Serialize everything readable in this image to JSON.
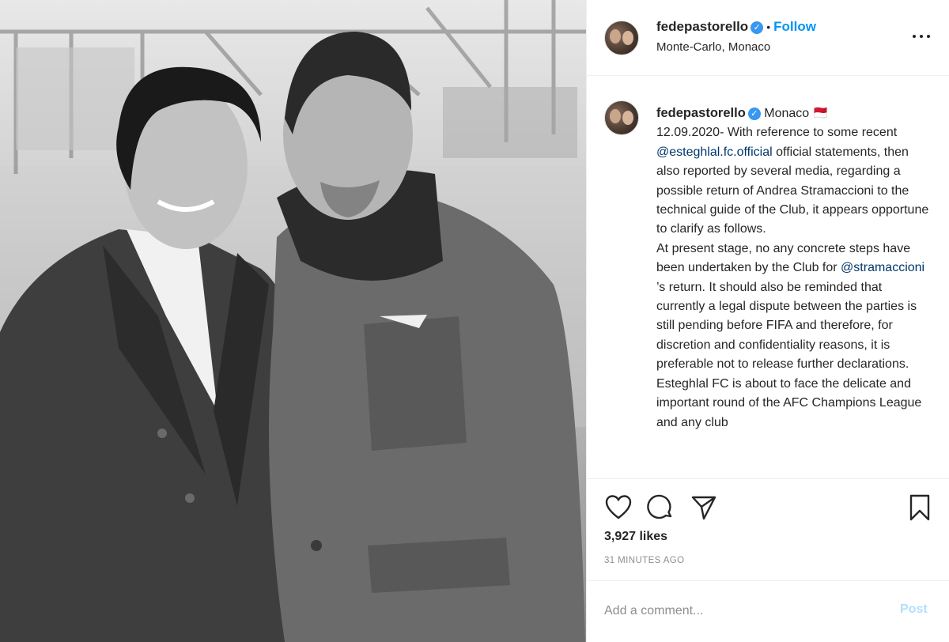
{
  "header": {
    "username": "fedepastorello",
    "follow_label": "Follow",
    "location": "Monte-Carlo, Monaco"
  },
  "caption": {
    "username": "fedepastorello",
    "location_tag": "Monaco 🇲🇨",
    "text_before_mention1": "12.09.2020- With reference to some recent ",
    "mention1": "@esteghlal.fc.official",
    "text_after_mention1": " official statements, then also reported by several media, regarding a possible return of Andrea Stramaccioni to the technical guide of the Club, it appears opportune to clarify as follows.",
    "text_before_mention2": "At present stage, no any concrete steps have been undertaken by the Club for ",
    "mention2": "@stramaccioni",
    "text_after_mention2": " ’s return. It should also be reminded that currently a legal dispute between the parties is still pending before FIFA and therefore, for discretion and confidentiality reasons, it is preferable not to release further declarations.",
    "text_tail": "Esteghlal FC is about to face the delicate and important round of the AFC Champions League and any club"
  },
  "stats": {
    "likes": "3,927 likes",
    "time": "31 MINUTES AGO"
  },
  "comment": {
    "placeholder": "Add a comment...",
    "post_label": "Post"
  },
  "icons": {
    "verified": "verified-badge-icon",
    "more": "more-options-icon",
    "like": "heart-icon",
    "comment": "comment-bubble-icon",
    "share": "paper-plane-icon",
    "save": "bookmark-icon"
  },
  "colors": {
    "accent": "#0095f6",
    "verified": "#3897f0",
    "mention": "#00376b",
    "post_disabled": "#b2dffc",
    "muted": "#8e8e8e"
  }
}
